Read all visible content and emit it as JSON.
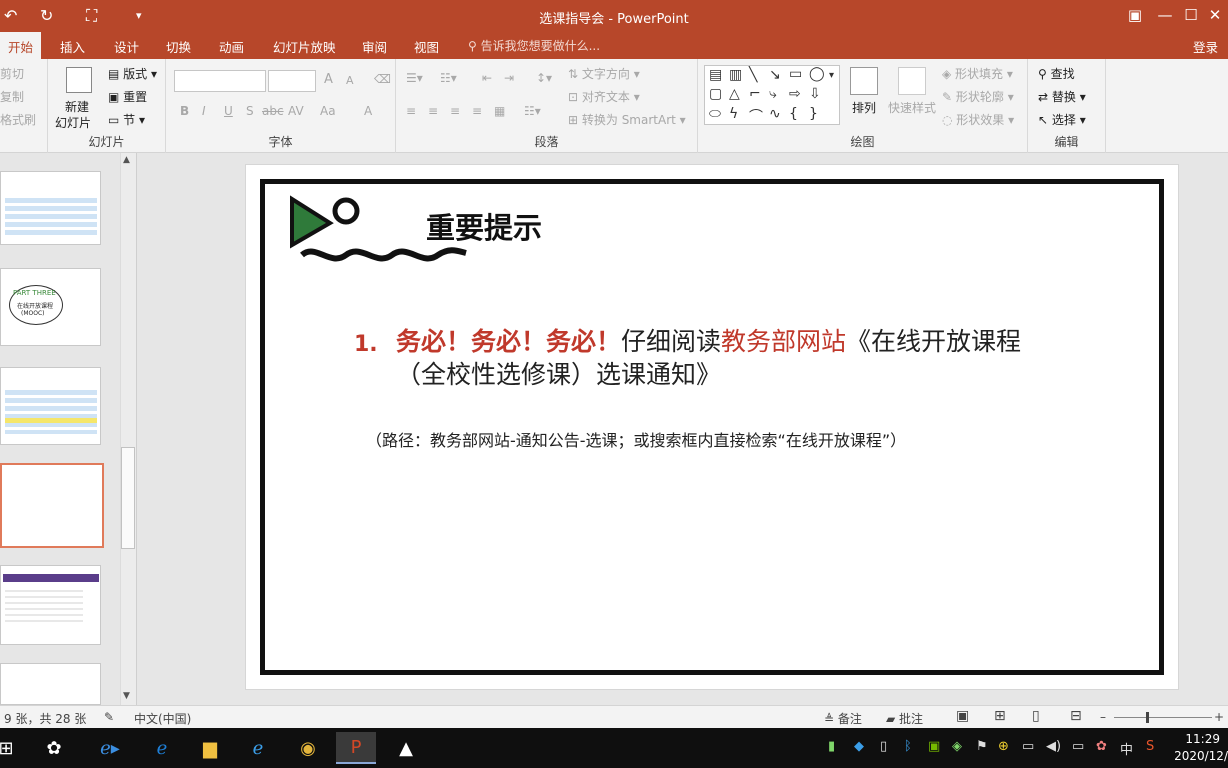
{
  "title_bar": {
    "title": "选课指导会 - PowerPoint",
    "undo_icon": "undo-icon",
    "redo_icon": "redo-icon",
    "start_from_beginning_icon": "present-icon",
    "customize_icon": "dropdown-arrow-icon",
    "restore_icon": "ribbon-display-icon",
    "minimize_glyph": "—",
    "maximize_glyph": "☐",
    "close_glyph": "✕"
  },
  "tabs": {
    "items": [
      "开始",
      "插入",
      "设计",
      "切换",
      "动画",
      "幻灯片放映",
      "审阅",
      "视图"
    ],
    "active": "开始",
    "tell_me": "告诉我您想要做什么...",
    "sign_in": "登录"
  },
  "ribbon": {
    "clipboard": {
      "cut": "剪切",
      "copy": "复制",
      "format_painter": "格式刷"
    },
    "slides": {
      "label": "幻灯片",
      "new_slide_line1": "新建",
      "new_slide_line2": "幻灯片",
      "layout": "版式",
      "reset": "重置",
      "section": "节"
    },
    "font": {
      "label": "字体",
      "bold": "B",
      "italic": "I",
      "underline": "U",
      "shadow": "S",
      "strike": "abc",
      "spacing": "AV",
      "case": "Aa",
      "color": "A",
      "grow": "A",
      "shrink": "A"
    },
    "paragraph": {
      "label": "段落",
      "text_direction": "文字方向",
      "align_text": "对齐文本",
      "smartart": "转换为 SmartArt"
    },
    "drawing": {
      "label": "绘图",
      "arrange": "排列",
      "quick_styles": "快速样式",
      "shape_fill": "形状填充",
      "shape_outline": "形状轮廓",
      "shape_effects": "形状效果"
    },
    "editing": {
      "label": "编辑",
      "find": "查找",
      "replace": "替换",
      "select": "选择"
    }
  },
  "slide": {
    "heading": "重要提示",
    "item_number": "1.",
    "item_emphasis": "务必！务必！务必！",
    "item_part1": "仔细阅读",
    "item_link": "教务部网站",
    "item_part2": "《在线开放课程（全校性选修课）选课通知》",
    "path_note": "（路径：教务部网站-通知公告-选课；或搜索框内直接检索“在线开放课程”）"
  },
  "thumbnails": {
    "thumb2_tag": "PART THREE",
    "thumb2_title": "在线开放课程",
    "thumb2_sub": "(MOOC)"
  },
  "status_bar": {
    "slide_count": "9 张，共 28 张",
    "language": "中文(中国)",
    "notes": "备注",
    "comments": "批注"
  },
  "taskbar": {
    "time": "11:29",
    "date": "2020/12/",
    "ime": "中"
  },
  "colors": {
    "accent": "#b7472a",
    "emphasis_red": "#c0392b",
    "thumb_selected": "#e07a5a"
  }
}
